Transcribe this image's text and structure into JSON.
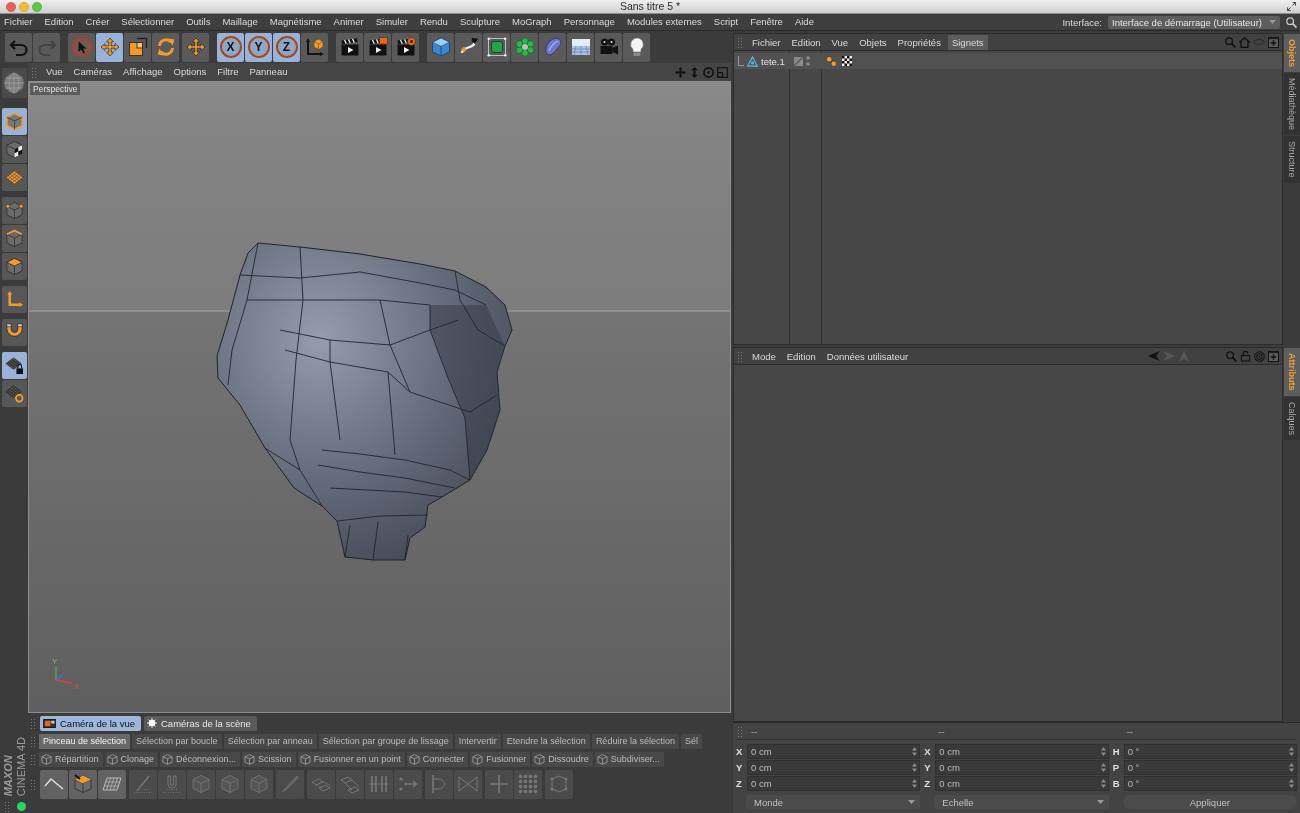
{
  "window": {
    "title": "Sans titre 5 *"
  },
  "menu_bar": {
    "items": [
      "Fichier",
      "Edition",
      "Créer",
      "Sélectionner",
      "Outils",
      "Maillage",
      "Magnétisme",
      "Animer",
      "Simuler",
      "Rendu",
      "Sculpture",
      "MoGraph",
      "Personnage",
      "Modules externes",
      "Script",
      "Fenêtre",
      "Aide"
    ],
    "interface_label": "Interface:",
    "interface_value": "Interface de démarrage (Utilisateur)"
  },
  "main_toolbar": {
    "history": [
      {
        "disabled": false
      },
      {
        "disabled": true
      }
    ],
    "tools": [
      {
        "selected": false
      },
      {
        "selected": true
      },
      {
        "selected": false
      },
      {
        "selected": false
      },
      {
        "selected": false
      }
    ],
    "axes": [
      {
        "label": "X",
        "selected": true
      },
      {
        "label": "Y",
        "selected": true
      },
      {
        "label": "Z",
        "selected": true
      }
    ]
  },
  "mode_toolbar": [
    {
      "selected": true
    },
    {
      "selected": false
    },
    {
      "selected": false
    },
    {
      "selected": false
    },
    {
      "selected": false
    },
    {
      "selected": false
    },
    {
      "selected": false
    },
    {
      "selected": false
    },
    {
      "selected": true
    },
    {
      "selected": false
    }
  ],
  "viewport": {
    "menu": [
      "Vue",
      "Caméras",
      "Affichage",
      "Options",
      "Filtre",
      "Panneau"
    ],
    "camera_label": "Perspective",
    "axis_labels": [
      "Y",
      "X"
    ]
  },
  "viewport_tabs": [
    {
      "label": "Caméra de la vue",
      "selected": true
    },
    {
      "label": "Caméras de la scène",
      "selected": false
    }
  ],
  "selection_commands": [
    {
      "label": "Pinceau de sélection",
      "disabled": false
    },
    {
      "label": "Sélection par boucle",
      "disabled": true
    },
    {
      "label": "Sélection par anneau",
      "disabled": true
    },
    {
      "label": "Sélection par groupe de lissage",
      "disabled": true
    },
    {
      "label": "Intervertir",
      "disabled": true
    },
    {
      "label": "Etendre la sélection",
      "disabled": true
    },
    {
      "label": "Réduire la sélection",
      "disabled": true
    },
    {
      "label": "Sél",
      "disabled": true
    }
  ],
  "mesh_commands": [
    {
      "label": "Répartition",
      "disabled": true
    },
    {
      "label": "Clonage",
      "disabled": true
    },
    {
      "label": "Déconnexion...",
      "disabled": true
    },
    {
      "label": "Scission",
      "disabled": true
    },
    {
      "label": "Fusionner en un point",
      "disabled": true
    },
    {
      "label": "Connecter",
      "disabled": true
    },
    {
      "label": "Fusionner",
      "disabled": true
    },
    {
      "label": "Dissoudre",
      "disabled": true
    },
    {
      "label": "Subdiviser...",
      "disabled": true
    }
  ],
  "modeling_tools": [
    {
      "disabled": false
    },
    {
      "disabled": false
    },
    {
      "disabled": false
    },
    {
      "disabled": true
    },
    {
      "disabled": true
    },
    {
      "disabled": true
    },
    {
      "disabled": true
    },
    {
      "disabled": true
    },
    {
      "disabled": true
    },
    {
      "disabled": true
    },
    {
      "disabled": true
    },
    {
      "disabled": true
    },
    {
      "disabled": true
    },
    {
      "disabled": true
    },
    {
      "disabled": true
    },
    {
      "disabled": true
    },
    {
      "disabled": true
    },
    {
      "disabled": true
    }
  ],
  "logo": {
    "brand": "MAXON",
    "product": "CINEMA 4D"
  },
  "object_manager": {
    "menu": [
      {
        "label": "Fichier",
        "selected": false
      },
      {
        "label": "Edition",
        "selected": false
      },
      {
        "label": "Vue",
        "selected": false
      },
      {
        "label": "Objets",
        "selected": false
      },
      {
        "label": "Propriétés",
        "selected": false
      },
      {
        "label": "Signets",
        "selected": true
      }
    ],
    "objects": [
      {
        "name": "tete.1"
      }
    ]
  },
  "object_side_tabs": [
    {
      "label": "Objets",
      "selected": true
    },
    {
      "label": "Médiathèque",
      "selected": false
    },
    {
      "label": "Structure",
      "selected": false
    }
  ],
  "attribute_manager": {
    "menu": [
      "Mode",
      "Edition",
      "Données utilisateur"
    ],
    "navigation": [
      {
        "disabled": false
      },
      {
        "disabled": true
      },
      {
        "disabled": true
      }
    ]
  },
  "attribute_side_tabs": [
    {
      "label": "Attributs",
      "selected": true
    },
    {
      "label": "Calques",
      "selected": false
    }
  ],
  "coordinates": {
    "columns": [
      {
        "header": "--",
        "fields": [
          {
            "axis": "X",
            "value": "0 cm"
          },
          {
            "axis": "Y",
            "value": "0 cm"
          },
          {
            "axis": "Z",
            "value": "0 cm"
          }
        ],
        "footer": {
          "kind": "dropdown",
          "label": "Monde"
        }
      },
      {
        "header": "--",
        "fields": [
          {
            "axis": "X",
            "value": "0 cm"
          },
          {
            "axis": "Y",
            "value": "0 cm"
          },
          {
            "axis": "Z",
            "value": "0 cm"
          }
        ],
        "footer": {
          "kind": "dropdown",
          "label": "Echelle"
        }
      },
      {
        "header": "--",
        "fields": [
          {
            "axis": "H",
            "value": "0 °"
          },
          {
            "axis": "P",
            "value": "0 °"
          },
          {
            "axis": "B",
            "value": "0 °"
          }
        ],
        "footer": {
          "kind": "button",
          "label": "Appliquer"
        }
      }
    ]
  }
}
